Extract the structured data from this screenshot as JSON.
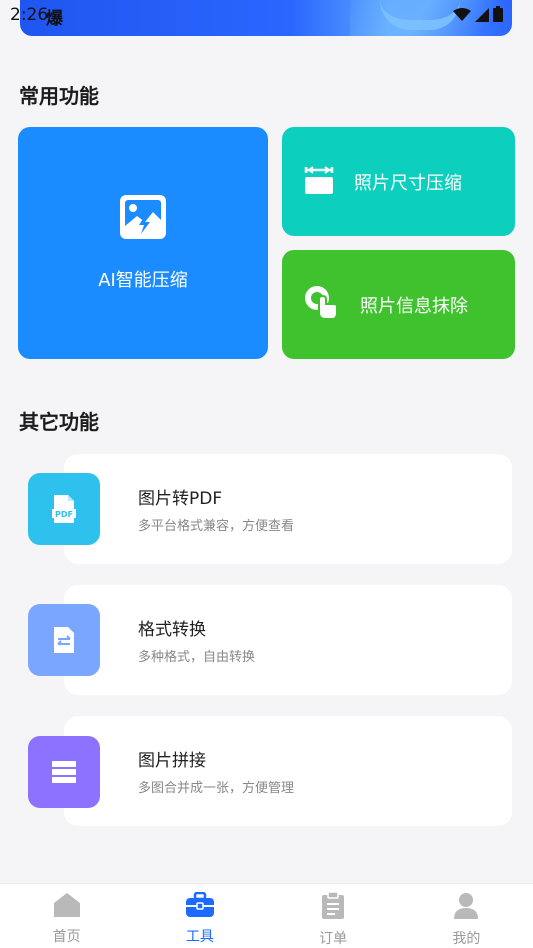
{
  "status_bar": {
    "time": "2:26",
    "extra": "爆"
  },
  "sections": {
    "common_title": "常用功能",
    "other_title": "其它功能"
  },
  "feature_cards": {
    "ai_compress": "AI智能压缩",
    "size_compress": "照片尺寸压缩",
    "info_erase": "照片信息抹除"
  },
  "other_features": [
    {
      "title": "图片转PDF",
      "subtitle": "多平台格式兼容，方便查看",
      "icon_text": "PDF"
    },
    {
      "title": "格式转换",
      "subtitle": "多种格式，自由转换"
    },
    {
      "title": "图片拼接",
      "subtitle": "多图合并成一张，方便管理"
    }
  ],
  "bottom_nav": [
    {
      "label": "首页",
      "icon": "home-icon"
    },
    {
      "label": "工具",
      "icon": "toolbox-icon"
    },
    {
      "label": "订单",
      "icon": "clipboard-icon"
    },
    {
      "label": "我的",
      "icon": "person-icon"
    }
  ],
  "colors": {
    "ai_card": "#1b8cff",
    "size_card": "#0dcfbd",
    "info_card": "#3fc22e",
    "pdf_icon_bg": "#2ec1ee",
    "convert_icon_bg": "#7aa6ff",
    "stitch_icon_bg": "#8c72ff",
    "active_nav": "#1b6bff"
  }
}
